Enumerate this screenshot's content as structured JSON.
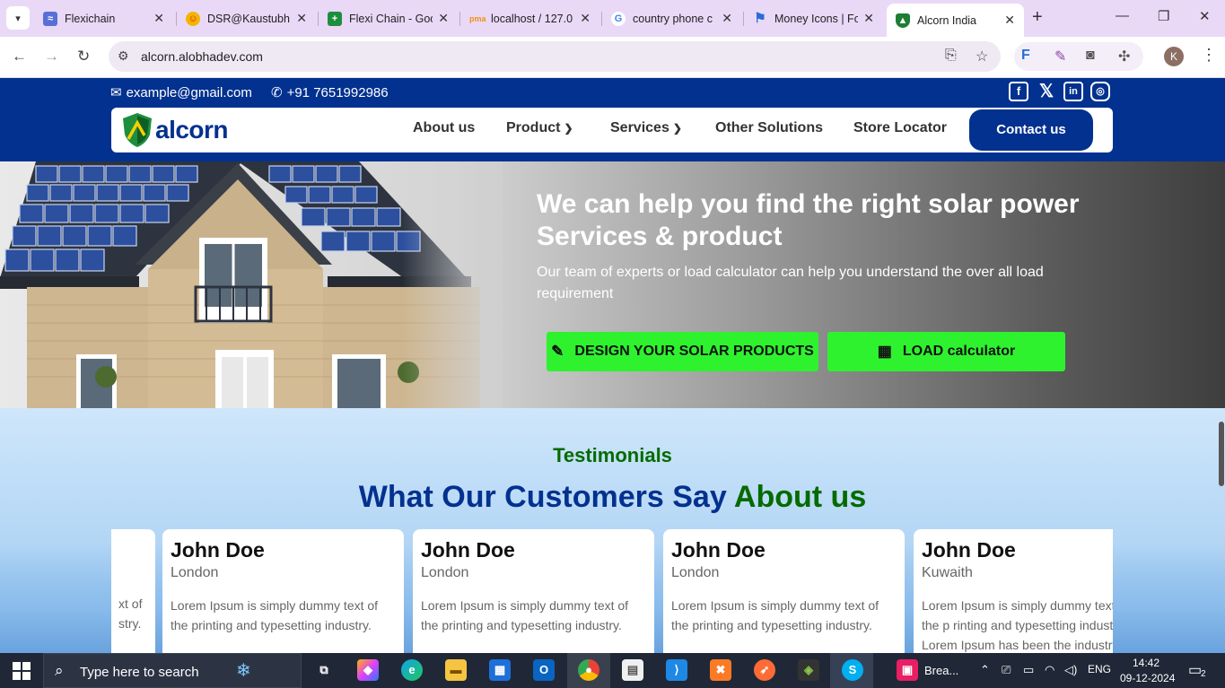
{
  "browser": {
    "tabs": [
      {
        "title": "Flexichain",
        "favicon": "flexichain-icon",
        "color": "#5a6fd6"
      },
      {
        "title": "DSR@Kaustubh",
        "favicon": "dsr-icon",
        "color": "#e65100"
      },
      {
        "title": "Flexi Chain - Goo",
        "favicon": "sheets-icon",
        "color": "#1e8e3e"
      },
      {
        "title": "localhost / 127.0",
        "favicon": "phpmyadmin-icon",
        "color": "#f29111"
      },
      {
        "title": "country phone c",
        "favicon": "google-icon",
        "color": "#4285f4"
      },
      {
        "title": "Money Icons | Fo",
        "favicon": "flag-icon",
        "color": "#2b6bd6"
      },
      {
        "title": "Alcorn India",
        "favicon": "alcorn-icon",
        "color": "#1e7e34"
      }
    ],
    "active_tab": 6,
    "url": "alcorn.alobhadev.com",
    "profile_initial": "K"
  },
  "site": {
    "email": "example@gmail.com",
    "phone": "+91 7651992986",
    "logo_text": "alcorn",
    "nav": [
      {
        "label": "About us",
        "has_dropdown": false
      },
      {
        "label": "Product",
        "has_dropdown": true
      },
      {
        "label": "Services",
        "has_dropdown": true
      },
      {
        "label": "Other Solutions",
        "has_dropdown": false
      },
      {
        "label": "Store Locator",
        "has_dropdown": false
      }
    ],
    "contact_button": "Contact us",
    "brand_color": "#03318f",
    "accent_color": "#2ef22e"
  },
  "hero": {
    "title": "We can help you find the right solar power Services & product",
    "subtitle": "Our team of experts or load calculator can help you understand the over all load requirement",
    "primary_button": "DESIGN YOUR SOLAR PRODUCTS",
    "secondary_button": "LOAD calculator"
  },
  "testimonials": {
    "eyebrow": "Testimonials",
    "heading_main": "What Our Customers Say",
    "heading_highlight": "About us",
    "partial_card_text": "xt of stry.",
    "cards": [
      {
        "name": "John Doe",
        "location": "London",
        "text": "Lorem Ipsum is simply dummy text of the printing and typesetting industry."
      },
      {
        "name": "John Doe",
        "location": "London",
        "text": "Lorem Ipsum is simply dummy text of the printing and typesetting industry."
      },
      {
        "name": "John Doe",
        "location": "London",
        "text": "Lorem Ipsum is simply dummy text of the printing and typesetting industry."
      },
      {
        "name": "John Doe",
        "location": "Kuwaith",
        "text": "Lorem Ipsum is simply dummy text of the p rinting and typesetting industry. Lorem Ipsum has been the industry's"
      }
    ]
  },
  "taskbar": {
    "search_placeholder": "Type here to search",
    "running_app": "Brea...",
    "language": "ENG",
    "time": "14:42",
    "date": "09-12-2024",
    "notification_count": "2"
  }
}
